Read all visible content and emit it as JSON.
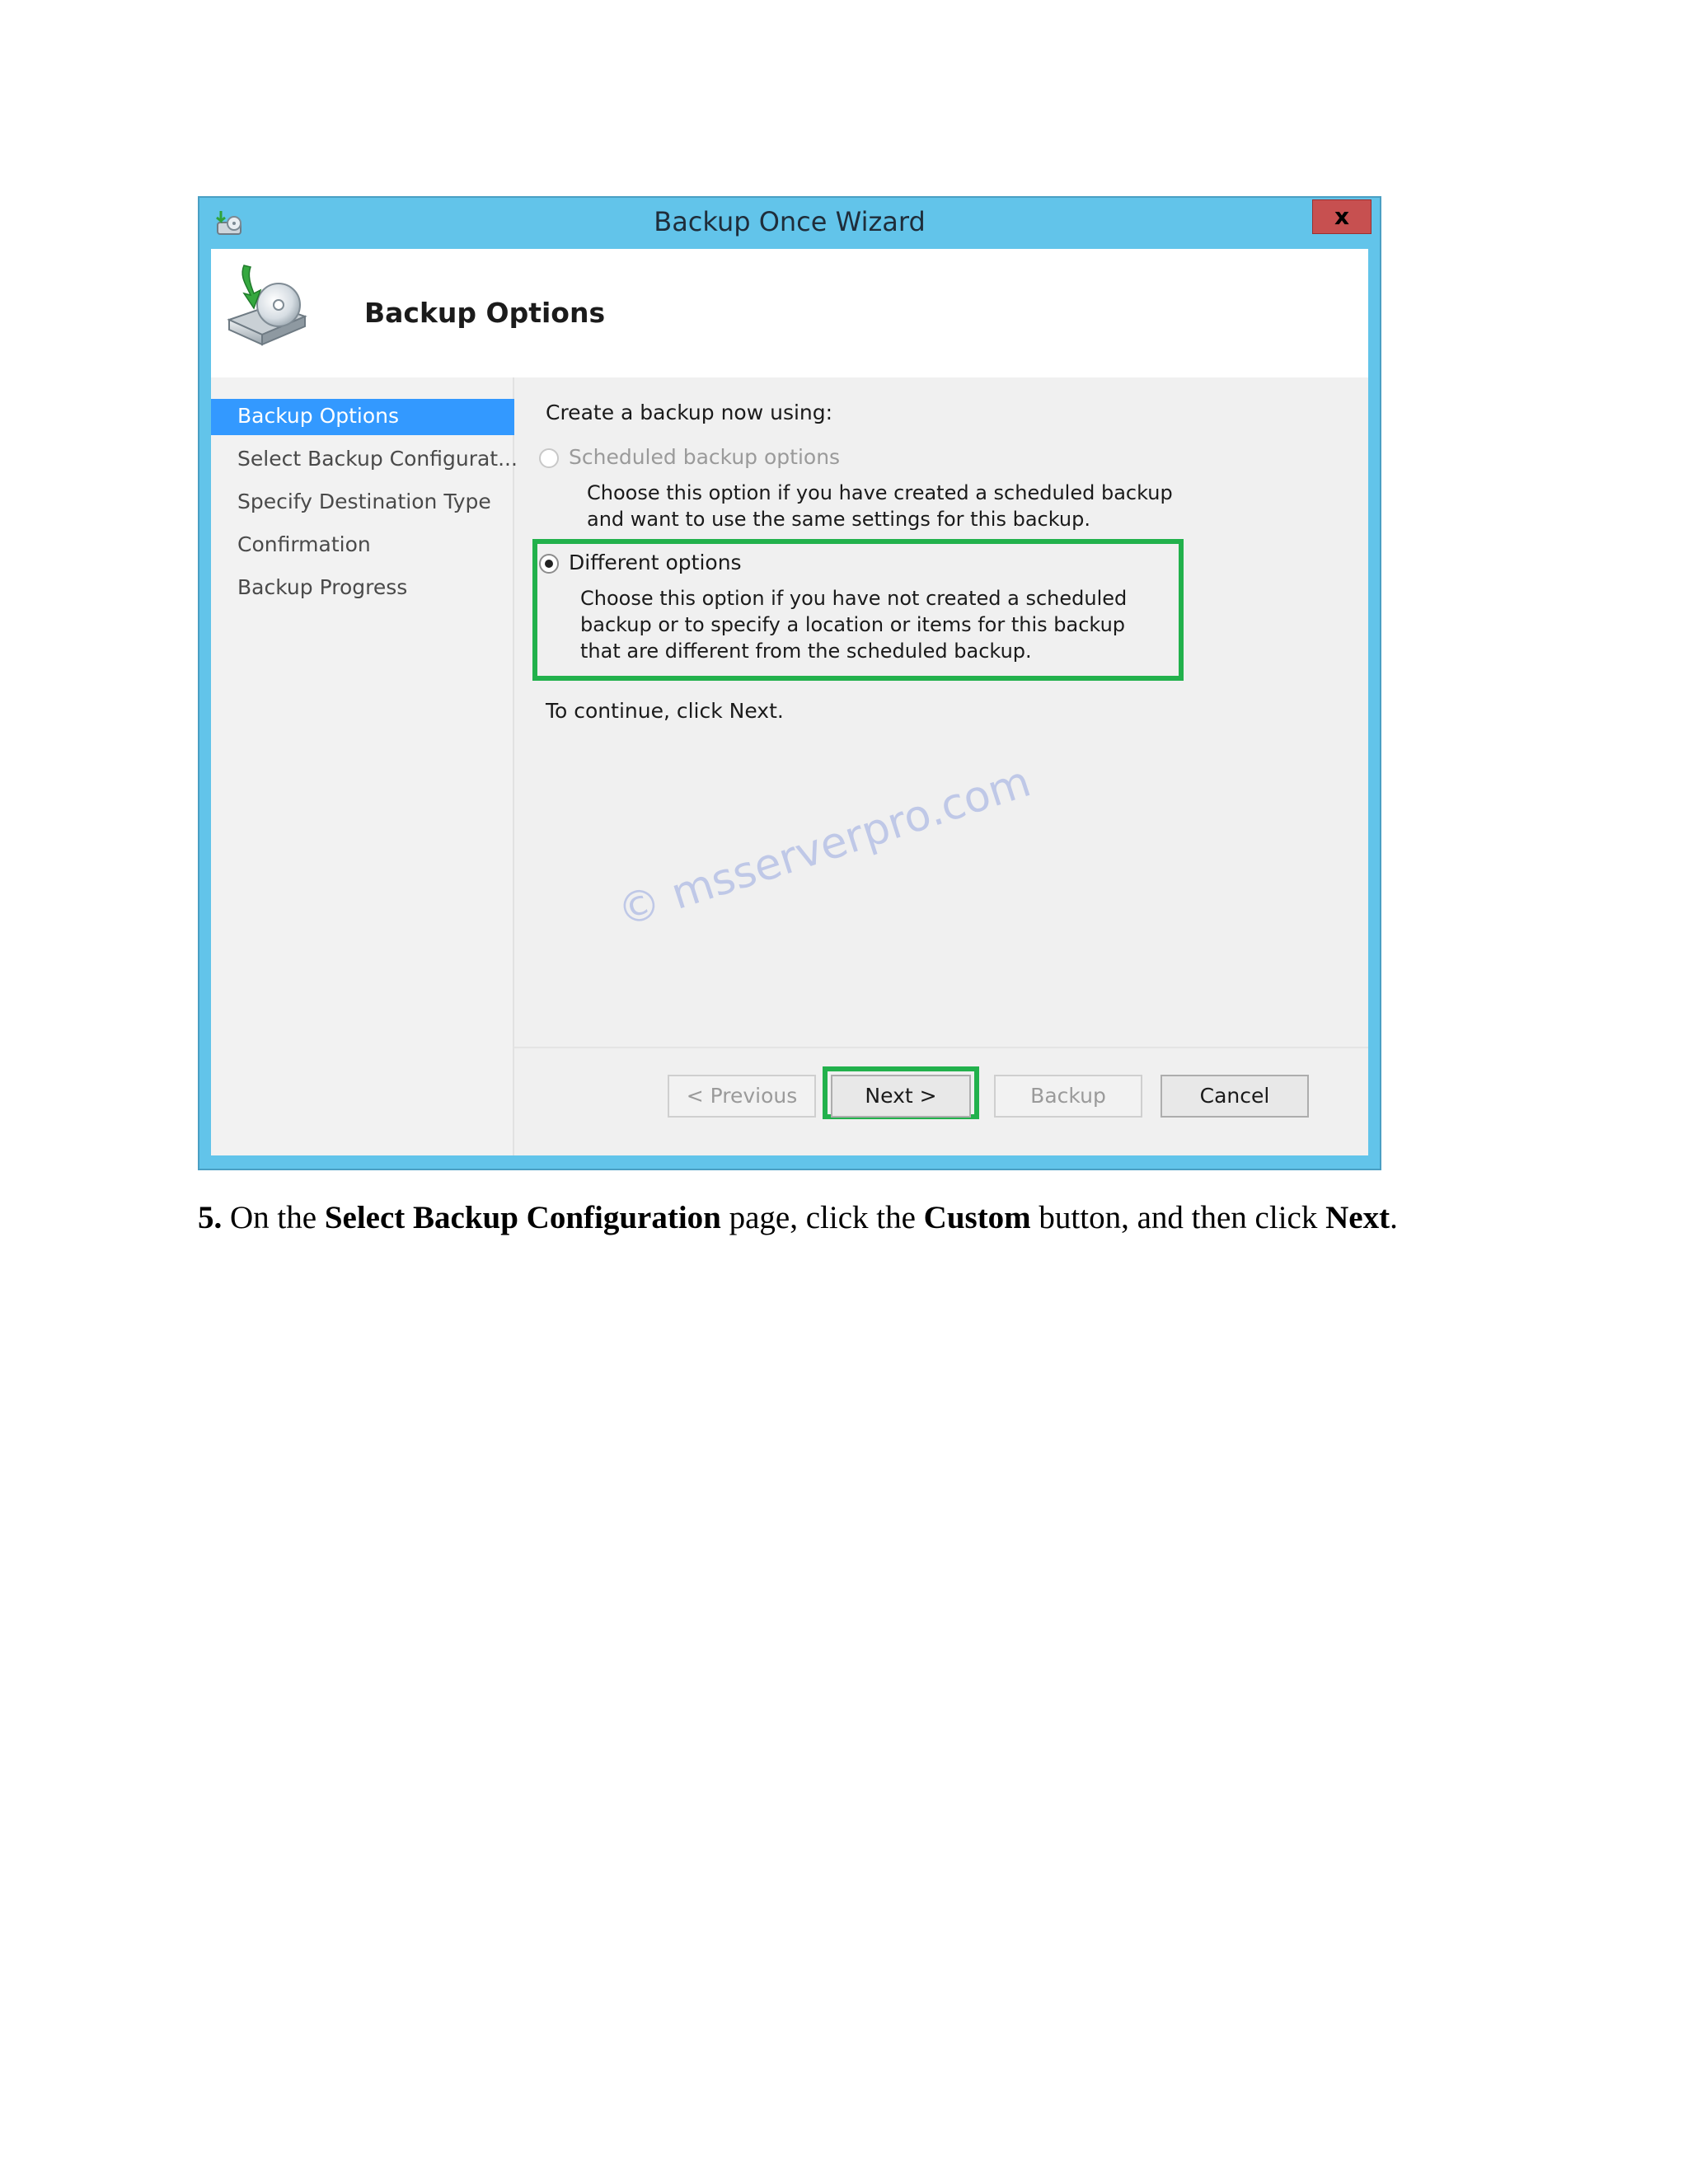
{
  "window": {
    "title": "Backup Once Wizard",
    "close_label": "x"
  },
  "header": {
    "title": "Backup Options"
  },
  "sidebar": {
    "items": [
      {
        "label": "Backup Options"
      },
      {
        "label": "Select Backup Configurat..."
      },
      {
        "label": "Specify Destination Type"
      },
      {
        "label": "Confirmation"
      },
      {
        "label": "Backup Progress"
      }
    ],
    "active_index": 0
  },
  "content": {
    "prompt": "Create a backup now using:",
    "option_scheduled": {
      "label": "Scheduled backup options",
      "description": "Choose this option if you have created a scheduled backup and want to use the same settings for this backup.",
      "selected": false,
      "enabled": false
    },
    "option_different": {
      "label": "Different options",
      "description": "Choose this option if you have not created a scheduled backup or to specify a location or items for this backup that are different from the scheduled backup.",
      "selected": true,
      "enabled": true
    },
    "continue_text": "To continue, click Next."
  },
  "buttons": {
    "previous": "< Previous",
    "next": "Next >",
    "backup": "Backup",
    "cancel": "Cancel"
  },
  "watermark": "© msserverpro.com",
  "instruction": {
    "number": "5.",
    "part1": "On the",
    "bold1": "Select Backup Configuration",
    "part2": "page, click the",
    "bold2": "Custom",
    "part3": "button, and then click",
    "bold3": "Next",
    "part4": "."
  },
  "colors": {
    "titlebar": "#62c4ea",
    "selection": "#3399ff",
    "highlight": "#22b14c",
    "close_button": "#c75050"
  }
}
